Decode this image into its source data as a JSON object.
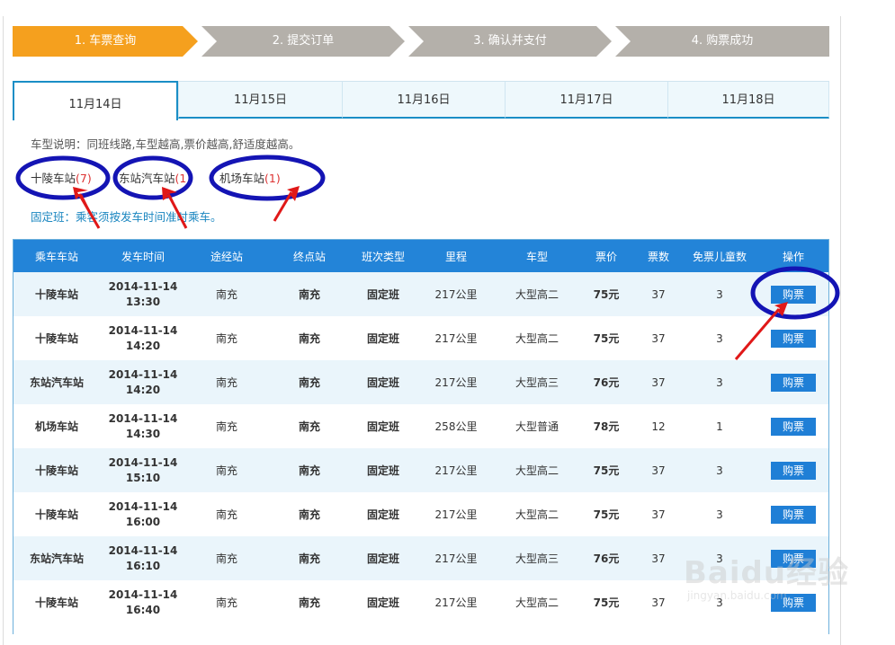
{
  "steps": [
    "1. 车票查询",
    "2. 提交订单",
    "3. 确认并支付",
    "4. 购票成功"
  ],
  "date_tabs": [
    "11月14日",
    "11月15日",
    "11月16日",
    "11月17日",
    "11月18日"
  ],
  "bus_type_note": "车型说明：同班线路,车型越高,票价越高,舒适度越高。",
  "station_filters": [
    {
      "name": "十陵车站",
      "count": "(7)"
    },
    {
      "name": "东站汽车站",
      "count": "(1)"
    },
    {
      "name": "机场车站",
      "count": "(1)"
    }
  ],
  "fixed_note": "固定班：乘客须按发车时间准时乘车。",
  "table": {
    "headers": [
      "乘车车站",
      "发车时间",
      "途经站",
      "终点站",
      "班次类型",
      "里程",
      "车型",
      "票价",
      "票数",
      "免票儿童数",
      "操作"
    ],
    "buy_label": "购票",
    "rows": [
      {
        "station": "十陵车站",
        "date": "2014-11-14",
        "time": "13:30",
        "via": "南充",
        "dest": "南充",
        "type": "固定班",
        "distance": "217公里",
        "model": "大型高二",
        "price": "75元",
        "tickets": "37",
        "free_children": "3"
      },
      {
        "station": "十陵车站",
        "date": "2014-11-14",
        "time": "14:20",
        "via": "南充",
        "dest": "南充",
        "type": "固定班",
        "distance": "217公里",
        "model": "大型高二",
        "price": "75元",
        "tickets": "37",
        "free_children": "3"
      },
      {
        "station": "东站汽车站",
        "date": "2014-11-14",
        "time": "14:20",
        "via": "南充",
        "dest": "南充",
        "type": "固定班",
        "distance": "217公里",
        "model": "大型高三",
        "price": "76元",
        "tickets": "37",
        "free_children": "3"
      },
      {
        "station": "机场车站",
        "date": "2014-11-14",
        "time": "14:30",
        "via": "南充",
        "dest": "南充",
        "type": "固定班",
        "distance": "258公里",
        "model": "大型普通",
        "price": "78元",
        "tickets": "12",
        "free_children": "1"
      },
      {
        "station": "十陵车站",
        "date": "2014-11-14",
        "time": "15:10",
        "via": "南充",
        "dest": "南充",
        "type": "固定班",
        "distance": "217公里",
        "model": "大型高二",
        "price": "75元",
        "tickets": "37",
        "free_children": "3"
      },
      {
        "station": "十陵车站",
        "date": "2014-11-14",
        "time": "16:00",
        "via": "南充",
        "dest": "南充",
        "type": "固定班",
        "distance": "217公里",
        "model": "大型高二",
        "price": "75元",
        "tickets": "37",
        "free_children": "3"
      },
      {
        "station": "东站汽车站",
        "date": "2014-11-14",
        "time": "16:10",
        "via": "南充",
        "dest": "南充",
        "type": "固定班",
        "distance": "217公里",
        "model": "大型高三",
        "price": "76元",
        "tickets": "37",
        "free_children": "3"
      },
      {
        "station": "十陵车站",
        "date": "2014-11-14",
        "time": "16:40",
        "via": "南充",
        "dest": "南充",
        "type": "固定班",
        "distance": "217公里",
        "model": "大型高二",
        "price": "75元",
        "tickets": "37",
        "free_children": "3"
      }
    ]
  },
  "watermark": {
    "brand": "Baidu经验",
    "url": "jingyan.baidu.com"
  },
  "colors": {
    "step_active": "#f5a01e",
    "step_inactive": "#b4b0aa",
    "header_blue": "#2384d8",
    "button_blue": "#1f7fd6",
    "annotation_circle": "#1414b4",
    "annotation_arrow": "#e01818"
  }
}
